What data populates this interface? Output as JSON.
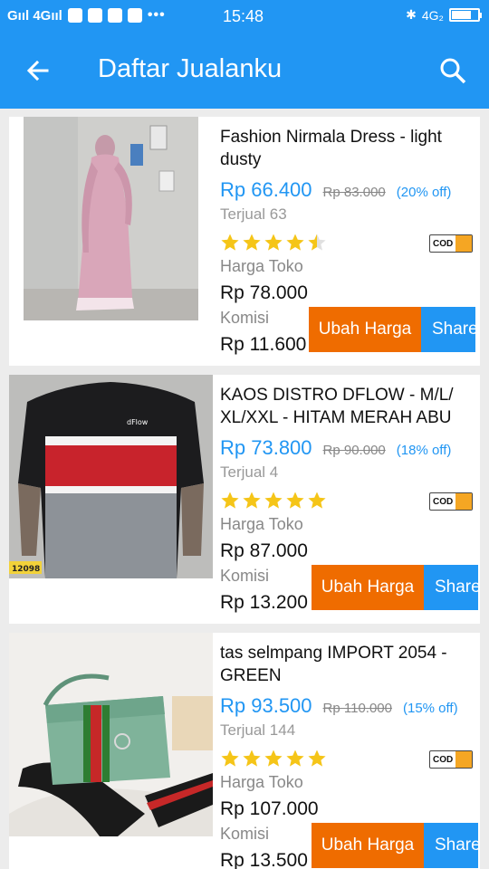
{
  "status_bar": {
    "network_left": "Gııl 4Gııl",
    "time": "15:48",
    "network_right": "4G₂"
  },
  "app_bar": {
    "title": "Daftar Jualanku",
    "back_icon": "arrow-left-icon",
    "search_icon": "search-icon"
  },
  "labels": {
    "harga_toko": "Harga Toko",
    "komisi": "Komisi",
    "ubah_harga": "Ubah Harga",
    "share": "Share",
    "cod": "COD"
  },
  "products": [
    {
      "name": "Fashion Nirmala Dress - light dusty",
      "price": "Rp 66.400",
      "old_price": "Rp 83.000",
      "discount": "(20% off)",
      "sold": "Terjual 63",
      "rating": 4.5,
      "harga_toko": "Rp 78.000",
      "komisi": "Rp 11.600",
      "image": "pink-dress-photo"
    },
    {
      "name": "KAOS DISTRO DFLOW - M/L/ XL/XXL - HITAM MERAH ABU",
      "price": "Rp 73.800",
      "old_price": "Rp 90.000",
      "discount": "(18% off)",
      "sold": "Terjual 4",
      "rating": 5,
      "harga_toko": "Rp 87.000",
      "komisi": "Rp 13.200",
      "image": "tshirt-photo",
      "image_tag": "12098"
    },
    {
      "name": "tas selmpang IMPORT 2054 - GREEN",
      "price": "Rp 93.500",
      "old_price": "Rp 110.000",
      "discount": "(15% off)",
      "sold": "Terjual 144",
      "rating": 5,
      "harga_toko": "Rp 107.000",
      "komisi": "Rp 13.500",
      "image": "green-bag-photo"
    }
  ],
  "colors": {
    "primary": "#2196f3",
    "accent": "#ef6c00",
    "star": "#f5c518"
  }
}
